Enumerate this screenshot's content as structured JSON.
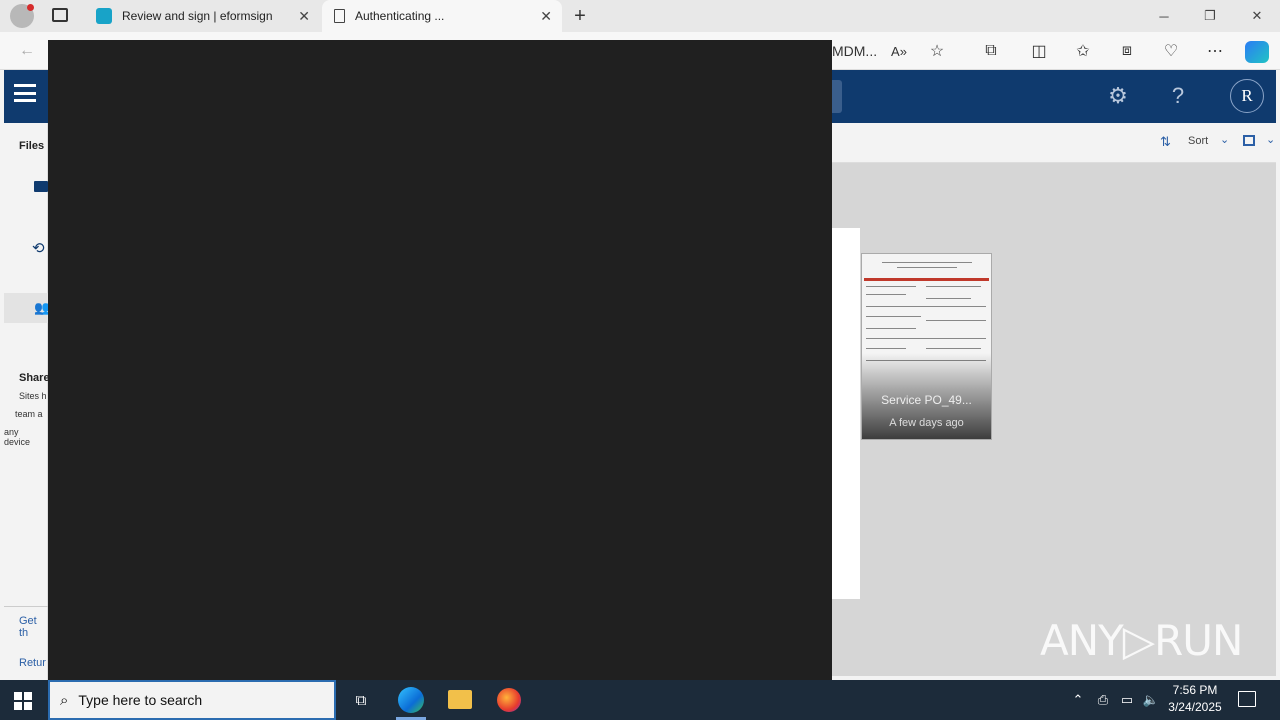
{
  "browser": {
    "tabs": [
      {
        "label": "Review and sign | eformsign",
        "close": "✕"
      },
      {
        "label": "Authenticating ...",
        "close": "✕"
      }
    ],
    "new_tab": "+",
    "address_fragment": "MDM...",
    "window_controls": {
      "minimize": "─",
      "restore": "❐",
      "close": "✕"
    }
  },
  "app": {
    "avatar_letter": "R",
    "toolbar": {
      "sort_label": "Sort"
    },
    "sidebar": {
      "section_title": "Files",
      "shared_title": "Share",
      "shared_desc_1": "Sites h",
      "shared_desc_2": "team a",
      "shared_desc_3": "any device",
      "get_link": "Get th",
      "return_link": "Retur"
    },
    "file": {
      "name": "Service PO_49...",
      "date": "A few days ago"
    }
  },
  "watermark": "ANY▷RUN",
  "taskbar": {
    "search_placeholder": "Type here to search",
    "time": "7:56 PM",
    "date": "3/24/2025"
  },
  "colors": {
    "header": "#0f3a6e",
    "overlay": "#202020",
    "taskbar": "#1c2b3a"
  }
}
